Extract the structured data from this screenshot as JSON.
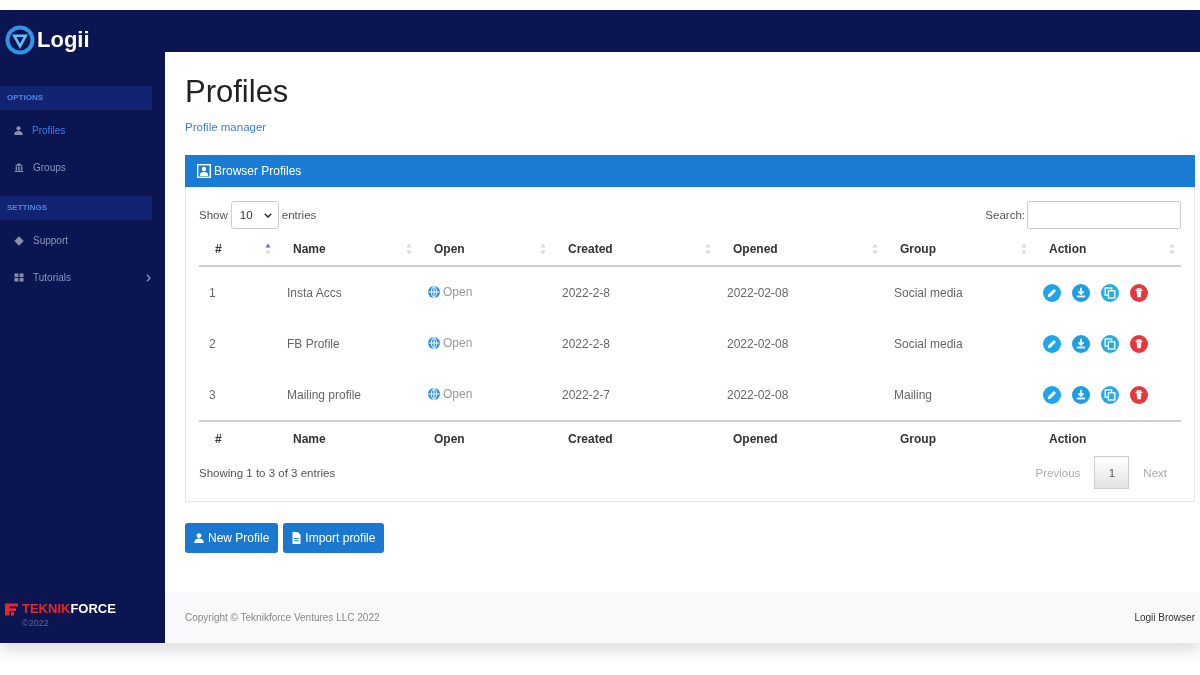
{
  "sidebar": {
    "logo": "Logii",
    "sections": [
      {
        "title": "OPTIONS",
        "items": [
          {
            "label": "Profiles",
            "selected": true,
            "submenu": false
          },
          {
            "label": "Groups",
            "selected": false,
            "submenu": false
          }
        ]
      },
      {
        "title": "SETTINGS",
        "items": [
          {
            "label": "Support",
            "selected": false,
            "submenu": false
          },
          {
            "label": "Tutorials",
            "selected": false,
            "submenu": true
          }
        ]
      }
    ],
    "brand": {
      "parts": [
        {
          "text": "TEKNIK",
          "color": "#e8262d"
        },
        {
          "text": "FORCE",
          "color": "#ffffff"
        }
      ],
      "year": "©2022"
    }
  },
  "page": {
    "title": "Profiles",
    "subtitle": "Profile manager"
  },
  "card": {
    "title": "Browser Profiles",
    "length_menu": {
      "before": "Show",
      "value": "10",
      "after": "entries"
    },
    "search": {
      "label": "Search:"
    },
    "table": {
      "columns": [
        {
          "label": "#",
          "sorted": true
        },
        {
          "label": "Name",
          "sorted": false
        },
        {
          "label": "Open",
          "sorted": false
        },
        {
          "label": "Created",
          "sorted": false
        },
        {
          "label": "Opened",
          "sorted": false
        },
        {
          "label": "Group",
          "sorted": false
        },
        {
          "label": "Action",
          "sorted": false
        }
      ],
      "rows": [
        {
          "number": "1",
          "name": "Insta Accs",
          "open": "Open",
          "created": "2022-2-8",
          "opened": "2022-02-08",
          "group": "Social media"
        },
        {
          "number": "2",
          "name": "FB Profile",
          "open": "Open",
          "created": "2022-2-8",
          "opened": "2022-02-08",
          "group": "Social media"
        },
        {
          "number": "3",
          "name": "Mailing profile",
          "open": "Open",
          "created": "2022-2-7",
          "opened": "2022-02-08",
          "group": "Mailing"
        }
      ],
      "footer": [
        "#",
        "Name",
        "Open",
        "Created",
        "Opened",
        "Group",
        "Action"
      ]
    },
    "info": "Showing 1 to 3 of 3 entries",
    "pagination": {
      "previous": {
        "label": "Previous",
        "disabled": true
      },
      "pages": [
        {
          "label": "1",
          "selected": true
        }
      ],
      "next": {
        "label": "Next",
        "disabled": true
      }
    }
  },
  "buttons": [
    {
      "label": "New Profile"
    },
    {
      "label": "Import profile"
    }
  ],
  "footer": {
    "copyright": "Copyright © Teknikforce Ventures LLC 2022",
    "app": "Logii Browser"
  }
}
